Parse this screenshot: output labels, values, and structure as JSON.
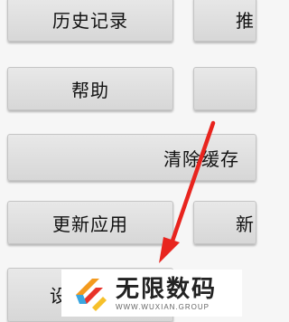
{
  "buttons": {
    "history": "历史记录",
    "right_top": "推",
    "help": "帮助",
    "clear_cache": "清除缓存",
    "update_app": "更新应用",
    "right_update": "新",
    "bottom": "设"
  },
  "watermark": {
    "brand_cn": "无限数码",
    "brand_en": "WWW.WUXIAN.GROUP"
  },
  "colors": {
    "arrow": "#e8241e",
    "button_bg": "#dcdcdc"
  }
}
